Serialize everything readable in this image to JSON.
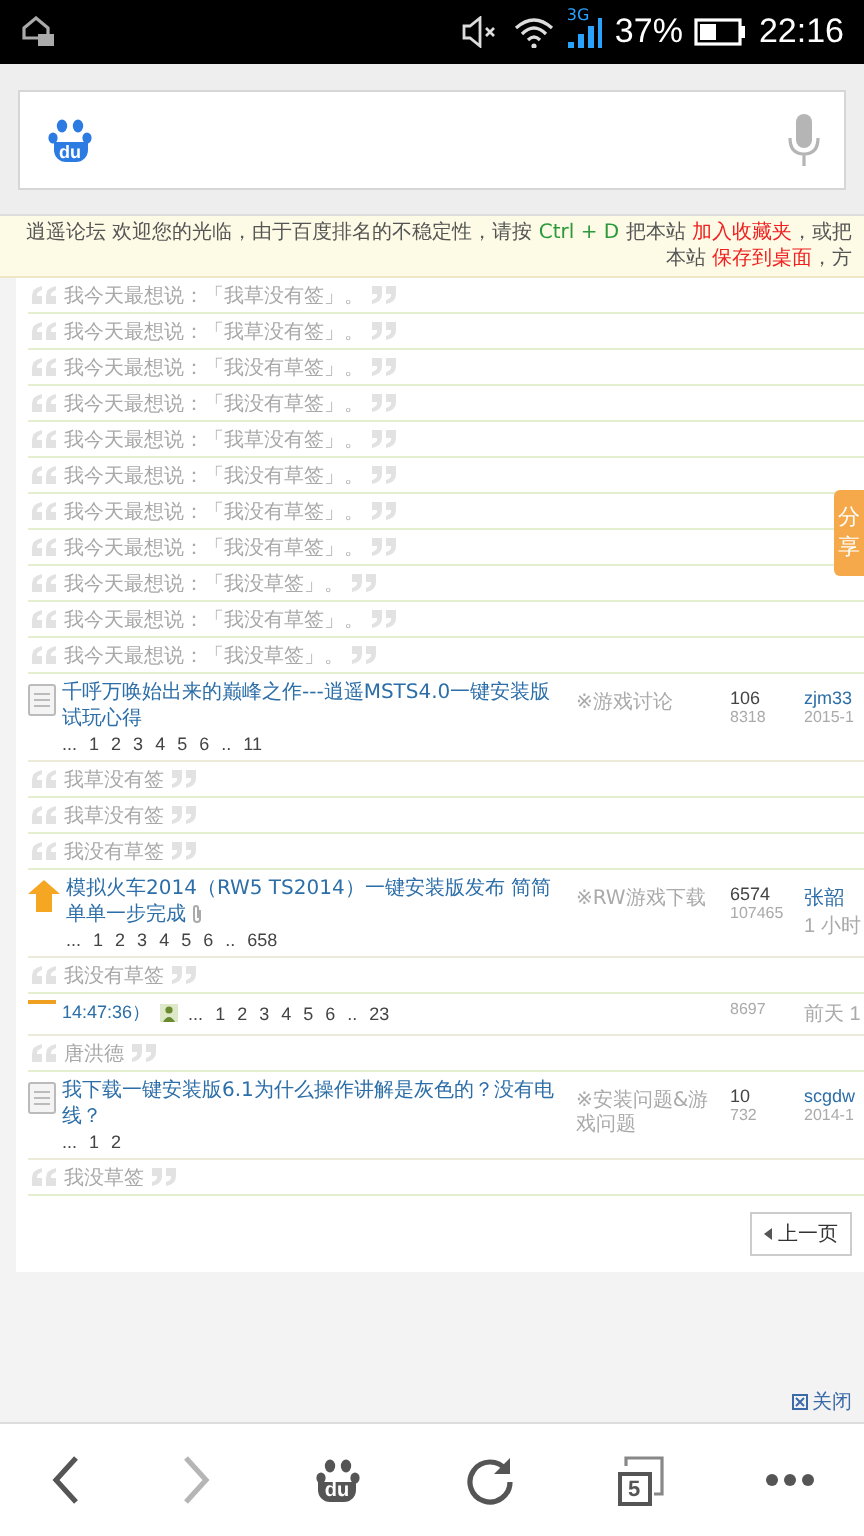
{
  "status_bar": {
    "network": "3G",
    "battery": "37%",
    "time": "22:16"
  },
  "search": {
    "logo_text": "du"
  },
  "notice": [
    {
      "kind": "plain",
      "text": "逍遥论坛 欢迎您的光临，由于百度排名的不稳定性，请按 "
    },
    {
      "kind": "key",
      "text": "Ctrl + D"
    },
    {
      "kind": "plain",
      "text": " 把本站 "
    },
    {
      "kind": "link",
      "text": "加入收藏夹"
    },
    {
      "kind": "plain",
      "text": "，或把本站 "
    },
    {
      "kind": "link",
      "text": "保存到桌面"
    },
    {
      "kind": "plain",
      "text": "，方"
    }
  ],
  "rows": [
    {
      "kind": "signature",
      "text": "我今天最想说：「我草没有签」。"
    },
    {
      "kind": "signature",
      "text": "我今天最想说：「我草没有签」。"
    },
    {
      "kind": "signature",
      "text": "我今天最想说：「我没有草签」。"
    },
    {
      "kind": "signature",
      "text": "我今天最想说：「我没有草签」。"
    },
    {
      "kind": "signature",
      "text": "我今天最想说：「我草没有签」。"
    },
    {
      "kind": "signature",
      "text": "我今天最想说：「我没有草签」。"
    },
    {
      "kind": "signature",
      "text": "我今天最想说：「我没有草签」。"
    },
    {
      "kind": "signature",
      "text": "我今天最想说：「我没有草签」。"
    },
    {
      "kind": "signature",
      "text": "我今天最想说：「我没草签」。"
    },
    {
      "kind": "signature",
      "text": "我今天最想说：「我没有草签」。"
    },
    {
      "kind": "signature",
      "text": "我今天最想说：「我没草签」。"
    },
    {
      "kind": "thread",
      "hot": false,
      "title": "千呼万唤始出来的巅峰之作---逍遥MSTS4.0一键安装版试玩心得",
      "attachment": false,
      "pages": [
        "...",
        "1",
        "2",
        "3",
        "4",
        "5",
        "6",
        "..",
        "11"
      ],
      "forum": "※游戏讨论",
      "replies": "106",
      "views": "8318",
      "author": "zjm33",
      "last": "2015-1"
    },
    {
      "kind": "signature",
      "text": "我草没有签"
    },
    {
      "kind": "signature",
      "text": "我草没有签"
    },
    {
      "kind": "signature",
      "text": "我没有草签"
    },
    {
      "kind": "thread",
      "hot": true,
      "title": "模拟火车2014（RW5 TS2014）一键安装版发布 简简单单一步完成",
      "attachment": true,
      "pages": [
        "...",
        "1",
        "2",
        "3",
        "4",
        "5",
        "6",
        "..",
        "658"
      ],
      "forum": "※RW游戏下载",
      "replies": "6574",
      "views": "107465",
      "author": "张韶",
      "last": "1 小时"
    },
    {
      "kind": "signature",
      "text": "我没有草签"
    },
    {
      "kind": "fragment",
      "time": "14:47:36）",
      "pages": [
        "...",
        "1",
        "2",
        "3",
        "4",
        "5",
        "6",
        "..",
        "23"
      ],
      "views": "8697",
      "last": "前天 1"
    },
    {
      "kind": "signature",
      "text": "唐洪德"
    },
    {
      "kind": "thread",
      "hot": false,
      "title": "我下载一键安装版6.1为什么操作讲解是灰色的？没有电线？",
      "attachment": false,
      "pages": [
        "...",
        "1",
        "2"
      ],
      "forum": "※安装问题&游戏问题",
      "replies": "10",
      "views": "732",
      "author": "scgdw",
      "last": "2014-1"
    },
    {
      "kind": "signature",
      "text": "我没草签"
    }
  ],
  "pagination": {
    "prev": "上一页"
  },
  "share": "分享",
  "close": "关闭",
  "toolbar": {
    "logo_text": "du",
    "tab_count": "5"
  }
}
